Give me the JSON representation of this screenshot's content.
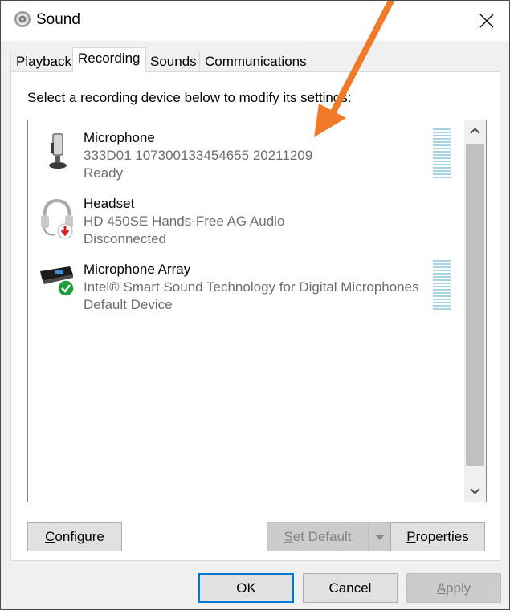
{
  "window": {
    "title": "Sound",
    "icon": "speaker-icon",
    "close_icon": "close-icon"
  },
  "tabs": [
    {
      "label": "Playback",
      "active": false
    },
    {
      "label": "Recording",
      "active": true
    },
    {
      "label": "Sounds",
      "active": false
    },
    {
      "label": "Communications",
      "active": false
    }
  ],
  "instruction": "Select a recording device below to modify its settings:",
  "devices": [
    {
      "name": "Microphone",
      "description": "333D01 107300133454655 20211209",
      "status": "Ready",
      "icon": "microphone-icon",
      "badge": "",
      "meter": true
    },
    {
      "name": "Headset",
      "description": "HD 450SE Hands-Free AG Audio",
      "status": "Disconnected",
      "icon": "headset-icon",
      "badge": "disconnected-badge-icon",
      "meter": false
    },
    {
      "name": "Microphone Array",
      "description": "Intel® Smart Sound Technology for Digital Microphones",
      "status": "Default Device",
      "icon": "microphone-array-icon",
      "badge": "default-check-badge-icon",
      "meter": true
    }
  ],
  "buttons": {
    "configure": {
      "label": "Configure",
      "mnemonic": "C",
      "rest": "onfigure"
    },
    "set_default": {
      "label": "Set Default",
      "mnemonic": "S",
      "rest": "et Default"
    },
    "properties": {
      "label": "Properties",
      "mnemonic": "P",
      "rest": "roperties"
    },
    "ok": {
      "label": "OK"
    },
    "cancel": {
      "label": "Cancel"
    },
    "apply": {
      "label": "Apply",
      "mnemonic": "A",
      "rest": "pply"
    }
  },
  "colors": {
    "accent": "#0078d7",
    "annotation_arrow": "#f07a28",
    "meter": "#a6d4e3",
    "default_badge": "#1e9e3a",
    "disconnected_badge": "#d42020"
  }
}
